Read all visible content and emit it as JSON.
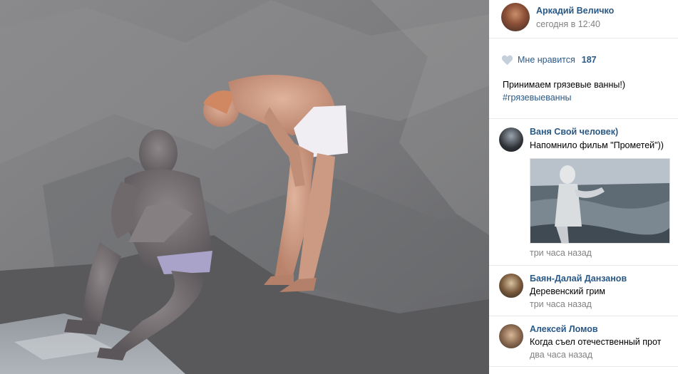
{
  "post": {
    "author_name": "Аркадий Величко",
    "timestamp": "сегодня в 12:40",
    "likes_label": "Мне нравится",
    "likes_count": "187",
    "caption": "Принимаем грязевые ванны!)",
    "hashtag": "#грязевыеванны"
  },
  "comments": [
    {
      "author": "Ваня Свой человек)",
      "text": "Напомнило фильм \"Прометей\"))",
      "time": "три часа назад",
      "has_image": true
    },
    {
      "author": "Баян-Далай Данзанов",
      "text": "Деревенский грим",
      "time": "три часа назад"
    },
    {
      "author": "Алексей Ломов",
      "text": "Когда съел отечественный прот",
      "time": "два часа назад"
    }
  ],
  "icons": {
    "like": "heart-icon"
  },
  "colors": {
    "link": "#2a5885",
    "muted": "#828282",
    "divider": "#e7e8ec",
    "heart": "#c5d0db"
  }
}
